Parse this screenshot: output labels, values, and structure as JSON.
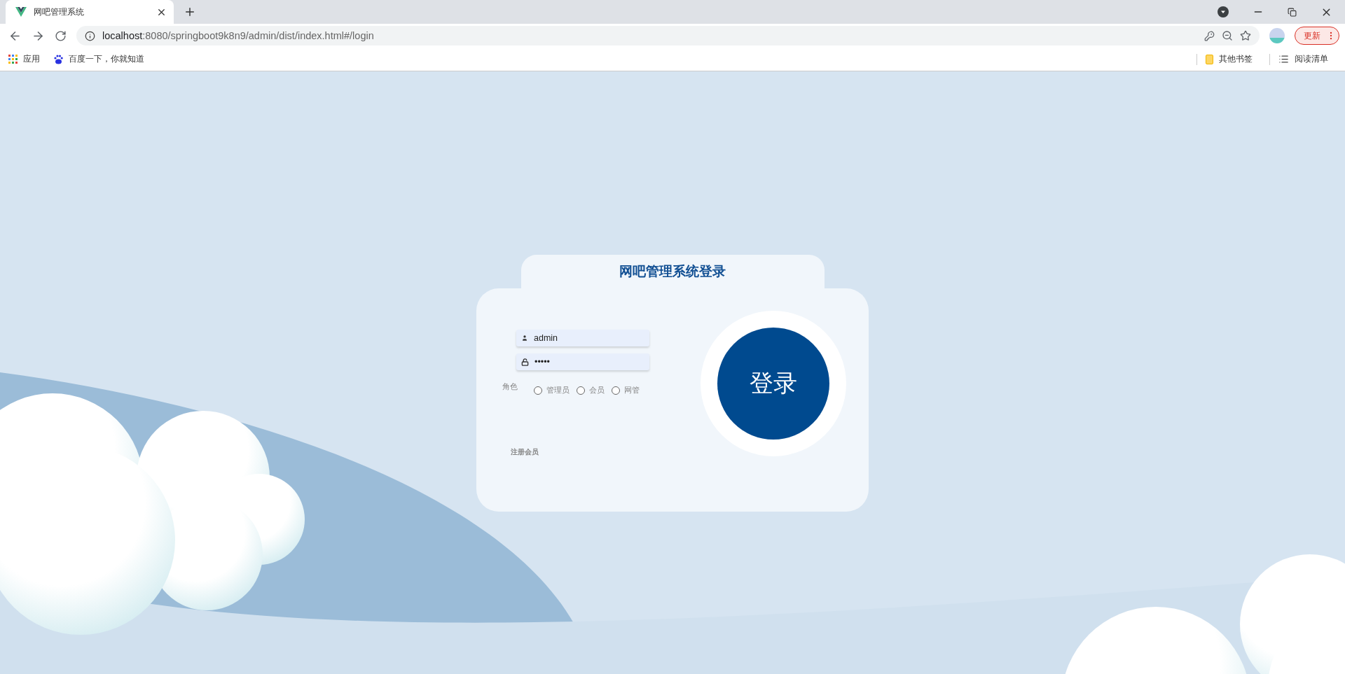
{
  "browser": {
    "tab": {
      "title": "网吧管理系统",
      "selected": true
    },
    "url_host": "localhost",
    "url_path": ":8080/springboot9k8n9/admin/dist/index.html#/login",
    "update_button": "更新",
    "bookmarks": [
      "应用",
      "百度一下，你就知道"
    ],
    "bookmarks_right": [
      "其他书签",
      "阅读清单"
    ]
  },
  "login": {
    "title": "网吧管理系统登录",
    "username": {
      "value": "admin"
    },
    "password": {
      "value": "•••••"
    },
    "role_label": "角色",
    "roles": [
      {
        "label": "管理员",
        "selected": false
      },
      {
        "label": "会员",
        "selected": false
      },
      {
        "label": "网管",
        "selected": false
      }
    ],
    "register_link": "注册会员",
    "login_button": "登录"
  }
}
